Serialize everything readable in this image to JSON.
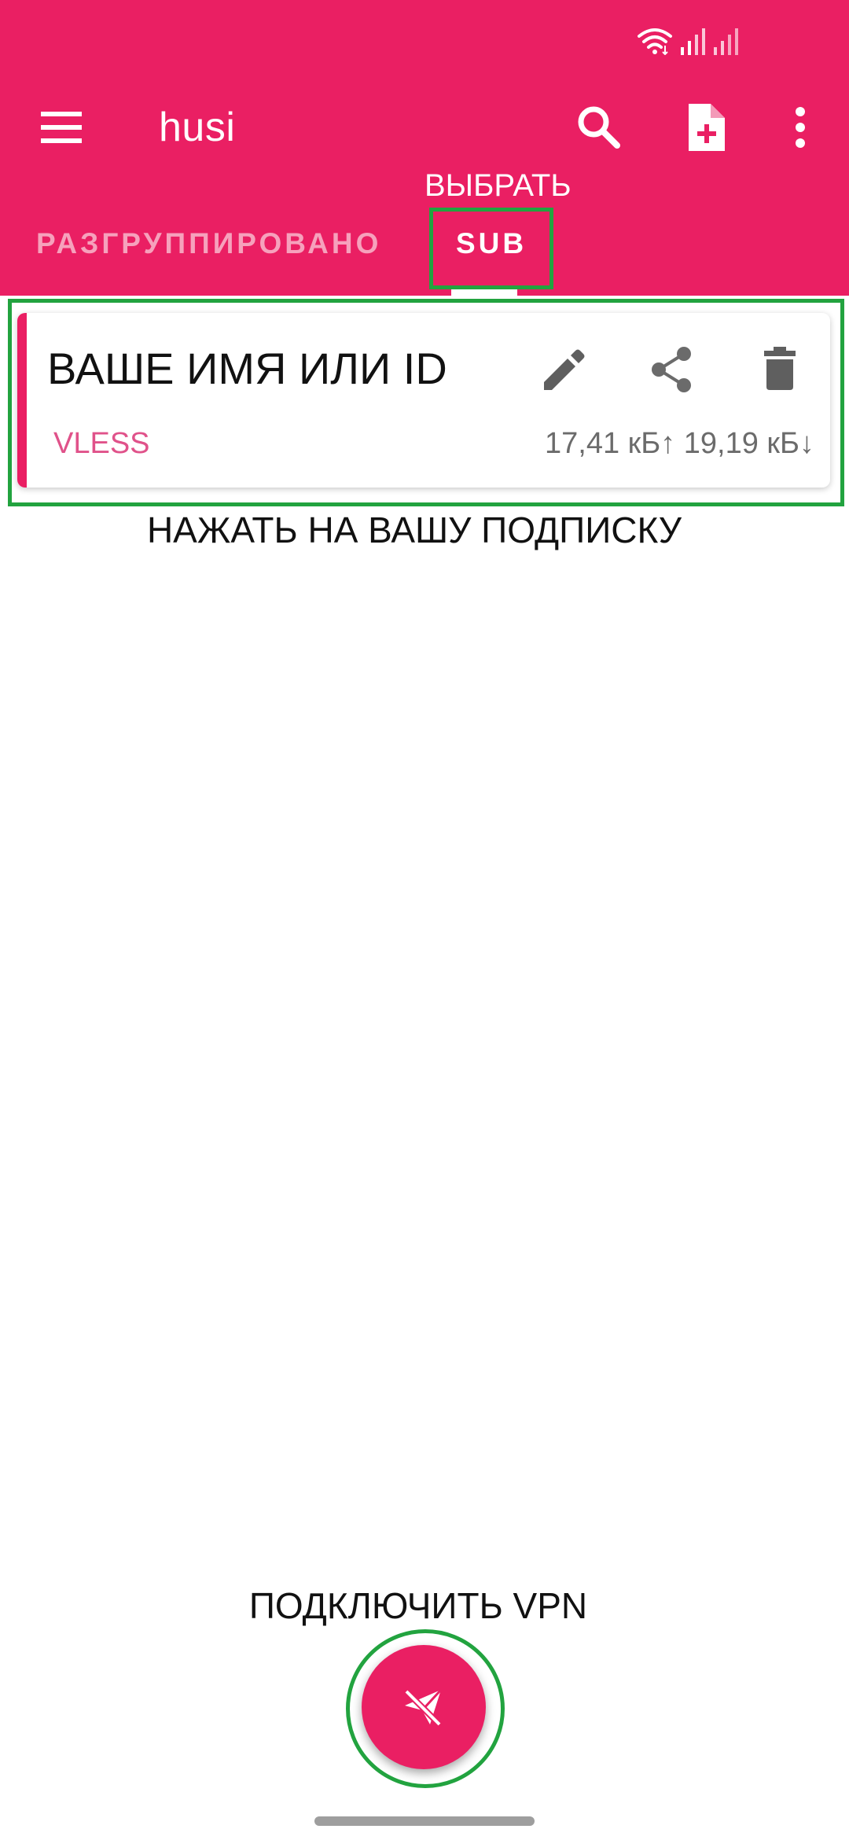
{
  "app": {
    "title": "husi"
  },
  "status_bar": {
    "icons": [
      "wifi-icon",
      "signal-bars-icon",
      "signal-bars-icon"
    ]
  },
  "toolbar": {
    "actions": [
      "search-icon",
      "add-file-icon",
      "more-vert-icon"
    ]
  },
  "tabs": [
    {
      "label": "РАЗГРУППИРОВАНО",
      "selected": false
    },
    {
      "label": "SUB",
      "selected": true
    }
  ],
  "subscription": {
    "name": "ВАШЕ ИМЯ ИЛИ ID",
    "type": "VLESS",
    "traffic": "17,41 кБ↑ 19,19 кБ↓",
    "actions": [
      "edit-icon",
      "share-icon",
      "delete-icon"
    ]
  },
  "annotations": {
    "select": "ВЫБРАТЬ",
    "tap_subscription": "НАЖАТЬ НА ВАШУ ПОДПИСКУ",
    "connect_vpn": "ПОДКЛЮЧИТЬ VPN"
  },
  "colors": {
    "primary": "#ea1f63",
    "highlight": "#22a33f",
    "tab_inactive": "#f6a1bc",
    "protocol_label": "#e0528a",
    "secondary_text": "#6b6b6b"
  },
  "fab": {
    "icon": "paper-plane-off-icon"
  }
}
